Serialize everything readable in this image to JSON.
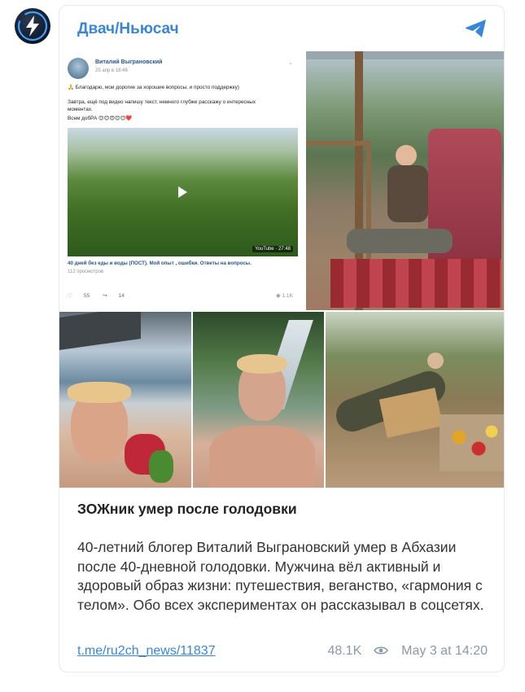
{
  "channel": {
    "name": "Двач/Ньюсач"
  },
  "vk_post": {
    "author": "Виталий Выграновский",
    "date": "25 апр в 18:46",
    "line1": "🙏 Благодарю, мои дорогие за хорошие вопросы, и просто поддержку)",
    "line2": "Завтра, ещё под видео напишу текст, немного глубже расскажу о интересных",
    "line3": "моментах.",
    "line4": "Всем добРА 😊😊😍😊😊❤️",
    "video_duration": "YouTube · 27:48",
    "video_title": "40 дней без еды и воды (ПОСТ). Мой опыт , ошибки. Ответы на вопросы.",
    "video_views": "112 просмотров",
    "likes": "55",
    "shares": "14",
    "views": "1.1K"
  },
  "post": {
    "title": "ЗОЖник умер после голодовки",
    "body": "40-летний блогер Виталий Выграновский умер в Абхазии после 40-дневной голодовки. Мужчина вёл активный и здоровый образ жизни: путешествия, веганство, «гармония с телом». Обо всех экспериментах он рассказывал в соцсетях.",
    "link": "t.me/ru2ch_news/11837",
    "views": "48.1K",
    "time": "May 3 at 14:20"
  },
  "colors": {
    "accent": "#3a86d6",
    "muted": "#8c99a6"
  },
  "icons": [
    "channel-logo-icon",
    "telegram-icon",
    "play-icon",
    "heart-icon",
    "share-icon",
    "eye-icon"
  ]
}
